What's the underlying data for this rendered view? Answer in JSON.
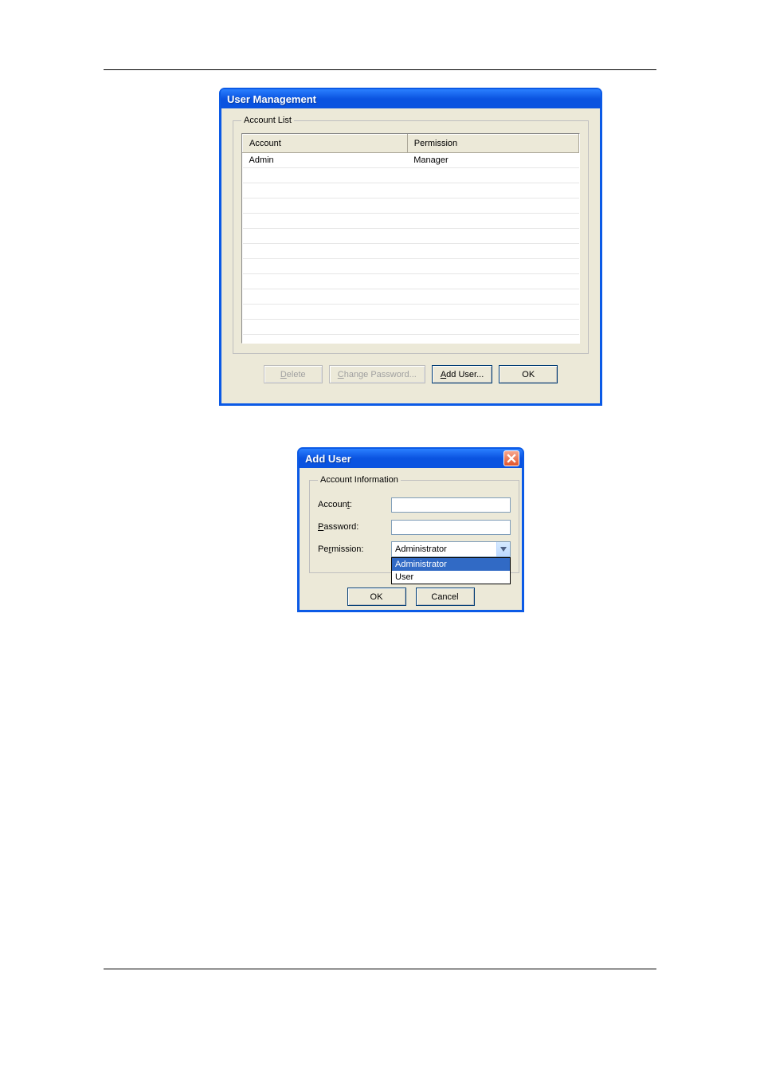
{
  "userManagement": {
    "title": "User Management",
    "group_label": "Account List",
    "columns": {
      "account": "Account",
      "permission": "Permission"
    },
    "rows": [
      {
        "account": "Admin",
        "permission": "Manager"
      }
    ],
    "empty_row_count": 12,
    "buttons": {
      "delete_pre": "",
      "delete_mn": "D",
      "delete_post": "elete",
      "change_pre": "",
      "change_mn": "C",
      "change_post": "hange Password...",
      "add_pre": "",
      "add_mn": "A",
      "add_post": "dd User...",
      "ok": "OK"
    }
  },
  "addUser": {
    "title": "Add User",
    "group_label": "Account Information",
    "labels": {
      "account_pre": "Accoun",
      "account_mn": "t",
      "account_post": ":",
      "password_pre": "",
      "password_mn": "P",
      "password_post": "assword:",
      "permission_pre": "Pe",
      "permission_mn": "r",
      "permission_post": "mission:"
    },
    "values": {
      "account": "",
      "password": ""
    },
    "permission_selected": "Administrator",
    "permission_options": [
      {
        "label": "Administrator",
        "selected": true
      },
      {
        "label": "User",
        "selected": false
      }
    ],
    "buttons": {
      "ok": "OK",
      "cancel": "Cancel"
    }
  }
}
